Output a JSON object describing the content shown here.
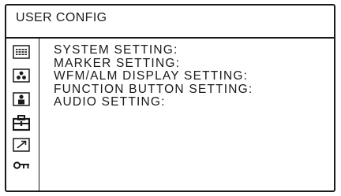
{
  "window": {
    "title": "USER CONFIG"
  },
  "sidebar": {
    "icons": [
      {
        "name": "camera-setting-icon",
        "active": false
      },
      {
        "name": "paint-icon",
        "active": false
      },
      {
        "name": "person-icon",
        "active": false
      },
      {
        "name": "toolbox-icon",
        "active": true
      },
      {
        "name": "file-arrow-icon",
        "active": false
      },
      {
        "name": "key-icon",
        "active": false
      }
    ]
  },
  "menu": {
    "items": [
      {
        "label": "SYSTEM SETTING:"
      },
      {
        "label": "MARKER SETTING:"
      },
      {
        "label": "WFM/ALM DISPLAY SETTING:"
      },
      {
        "label": "FUNCTION BUTTON SETTING:"
      },
      {
        "label": "AUDIO SETTING:"
      }
    ]
  },
  "colors": {
    "foreground": "#1a1a1a",
    "background": "#ffffff"
  }
}
